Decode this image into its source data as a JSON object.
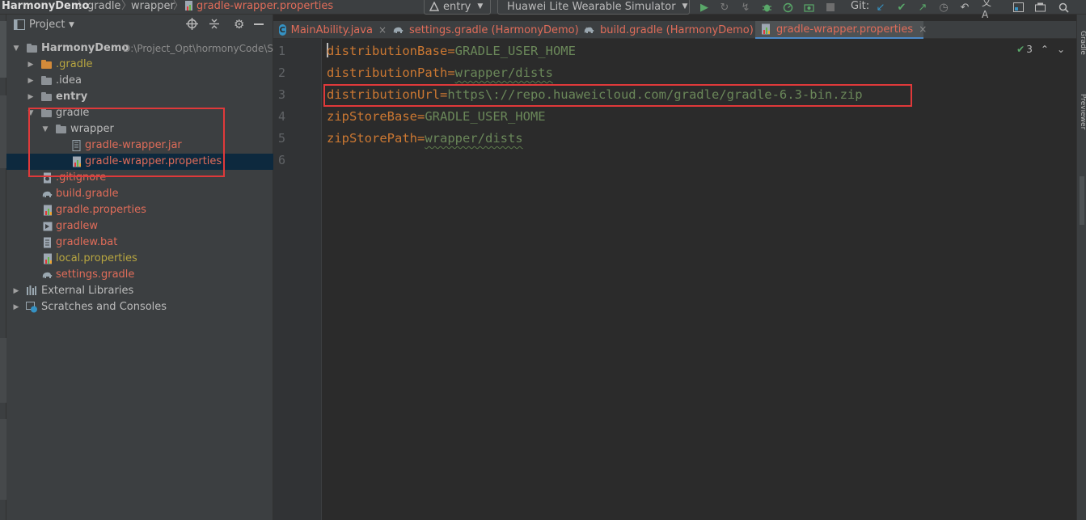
{
  "navbar": {
    "breadcrumbs": [
      "HarmonyDemo",
      "gradle",
      "wrapper",
      "gradle-wrapper.properties"
    ],
    "run_config": "entry",
    "device": "Huawei Lite Wearable Simulator",
    "git_label": "Git:"
  },
  "project_panel": {
    "title": "Project",
    "root": {
      "name": "HarmonyDemo",
      "path": "D:\\Project_Opt\\hormonyCode\\Sl"
    },
    "items": [
      {
        "label": ".gradle",
        "color": "#b8a640"
      },
      {
        "label": ".idea",
        "color": "#bbbbbb"
      },
      {
        "label": "entry",
        "color": "#bbbbbb"
      },
      {
        "label": "gradle",
        "color": "#bbbbbb"
      },
      {
        "label": "wrapper",
        "color": "#bbbbbb"
      },
      {
        "label": "gradle-wrapper.jar",
        "color": "#e06c59"
      },
      {
        "label": "gradle-wrapper.properties",
        "color": "#e06c59"
      },
      {
        "label": ".gitignore",
        "color": "#e06c59"
      },
      {
        "label": "build.gradle",
        "color": "#e06c59"
      },
      {
        "label": "gradle.properties",
        "color": "#e06c59"
      },
      {
        "label": "gradlew",
        "color": "#e06c59"
      },
      {
        "label": "gradlew.bat",
        "color": "#e06c59"
      },
      {
        "label": "local.properties",
        "color": "#b8a640"
      },
      {
        "label": "settings.gradle",
        "color": "#e06c59"
      },
      {
        "label": "External Libraries",
        "color": "#bbbbbb"
      },
      {
        "label": "Scratches and Consoles",
        "color": "#bbbbbb"
      }
    ]
  },
  "editor": {
    "tabs": [
      {
        "label": "MainAbility.java",
        "color": "#e06c59",
        "active": false
      },
      {
        "label": "settings.gradle (HarmonyDemo)",
        "color": "#e06c59",
        "active": false
      },
      {
        "label": "build.gradle (HarmonyDemo)",
        "color": "#e06c59",
        "active": false
      },
      {
        "label": "gradle-wrapper.properties",
        "color": "#e06c59",
        "active": true
      }
    ],
    "line_numbers": [
      "1",
      "2",
      "3",
      "4",
      "5",
      "6"
    ],
    "lines": [
      {
        "key": "distributionBase",
        "value": "GRADLE_USER_HOME"
      },
      {
        "key": "distributionPath",
        "value": "wrapper/dists"
      },
      {
        "key": "distributionUrl",
        "value": "https\\://repo.huaweicloud.com/gradle/gradle-6.3-bin.zip"
      },
      {
        "key": "zipStoreBase",
        "value": "GRADLE_USER_HOME"
      },
      {
        "key": "zipStorePath",
        "value": "wrapper/dists"
      }
    ],
    "inspection_count": "3"
  },
  "right_strip": {
    "labels": [
      "Gradle",
      "Previewer"
    ]
  },
  "colors": {
    "accent": "#4a88c7",
    "highlight_box": "#e0393a",
    "string": "#6a8759",
    "keyword": "#cc7832"
  }
}
